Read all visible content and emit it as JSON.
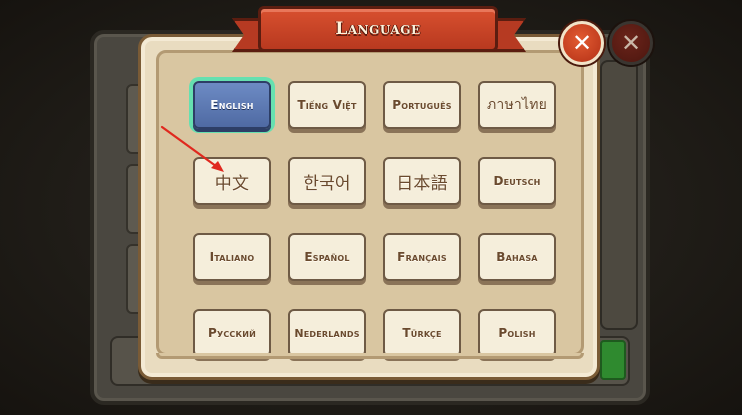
{
  "dialog": {
    "title": "Language",
    "close_icon": "close-icon",
    "accent_color": "#b8391f",
    "selected_color": "#5a76b0",
    "selected_language": "English"
  },
  "languages": [
    {
      "label": "English"
    },
    {
      "label": "Tiếng Việt"
    },
    {
      "label": "Português"
    },
    {
      "label": "ภาษาไทย"
    },
    {
      "label": "中文"
    },
    {
      "label": "한국어"
    },
    {
      "label": "日本語"
    },
    {
      "label": "Deutsch"
    },
    {
      "label": "Italiano"
    },
    {
      "label": "Español"
    },
    {
      "label": "Français"
    },
    {
      "label": "Bahasa"
    },
    {
      "label": "Русский"
    },
    {
      "label": "Nederlands"
    },
    {
      "label": "Türkçe"
    },
    {
      "label": "Polish"
    }
  ],
  "annotation": {
    "icon": "arrow-pointer-icon",
    "color": "#e0281e"
  }
}
